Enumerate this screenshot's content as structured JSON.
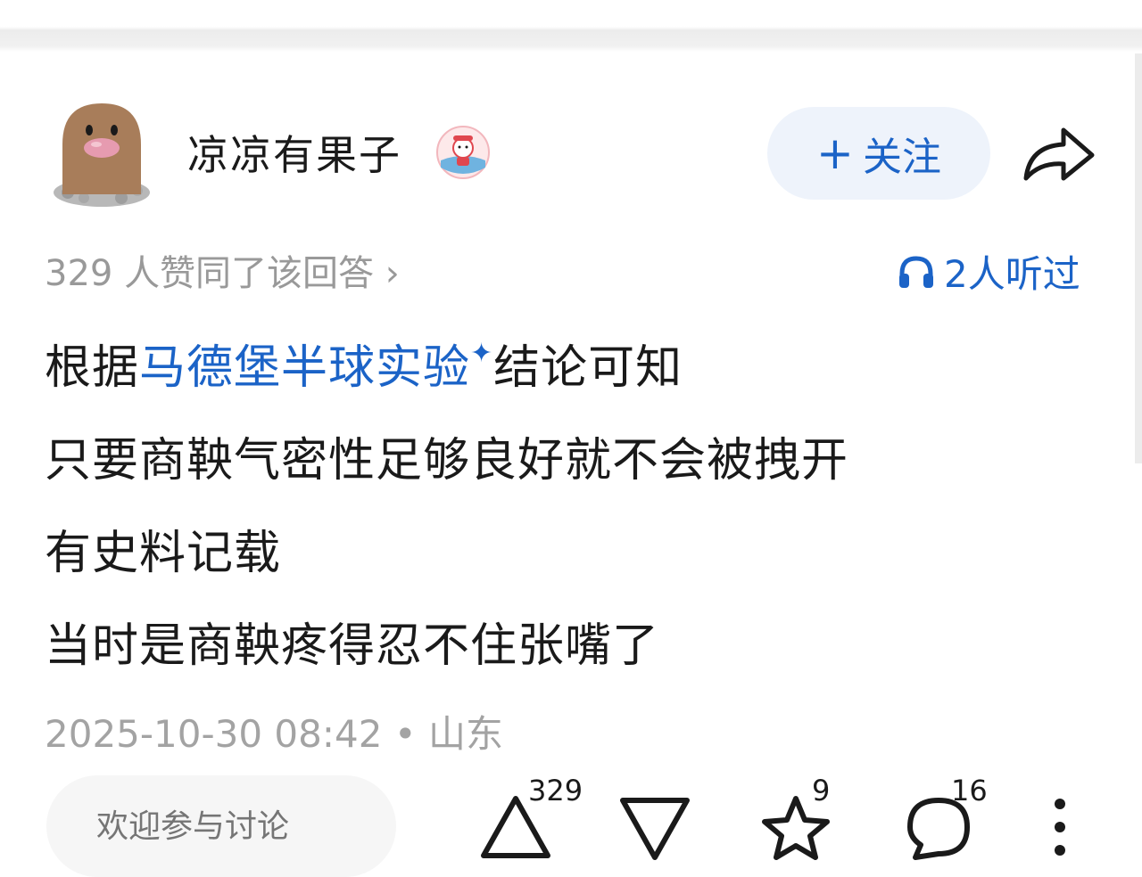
{
  "author": {
    "name": "凉凉有果子"
  },
  "follow_button": {
    "icon": "+",
    "label": "关注"
  },
  "stats": {
    "approve_text": "329 人赞同了该回答 ›",
    "listen_text": "2人听过"
  },
  "answer": {
    "line1": {
      "prefix": "根据",
      "link": "马德堡半球实验",
      "sparkle": "✦",
      "suffix": "结论可知"
    },
    "line2": "只要商鞅气密性足够良好就不会被拽开",
    "line3": "有史料记载",
    "line4": "当时是商鞅疼得忍不住张嘴了"
  },
  "timestamp": "2025-10-30 08:42 • 山东",
  "comment_input": {
    "placeholder": "欢迎参与讨论"
  },
  "actions": {
    "upvote_count": "329",
    "favorite_count": "9",
    "comment_count": "16"
  },
  "colors": {
    "accent": "#1b63c7",
    "follow_bg": "#eef3fb",
    "muted": "#999999"
  },
  "icons": [
    "avatar",
    "badge-icon",
    "share-icon",
    "headphones-icon",
    "upvote-icon",
    "downvote-icon",
    "star-icon",
    "comment-icon",
    "more-icon"
  ]
}
